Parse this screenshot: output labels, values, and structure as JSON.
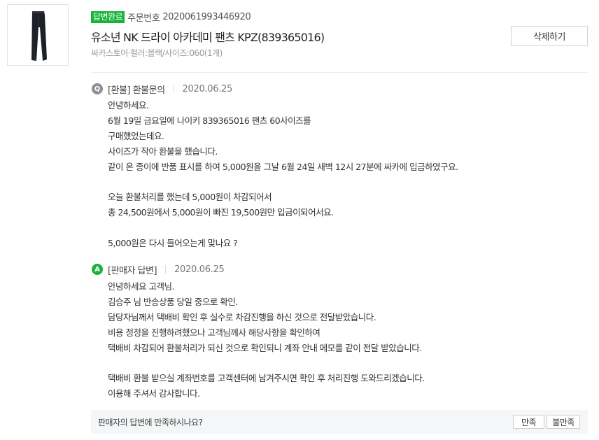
{
  "product": {
    "image_icon": "pants-image",
    "status_badge": "답변완료",
    "order_label": "주문번호",
    "order_number": "2020061993446920",
    "title": "유소년 NK 드라이 아카데미 팬츠 KPZ(839365016)",
    "option": "싸카스토어·컬러:블랙/사이즈:060(1개)",
    "delete_label": "삭제하기"
  },
  "question": {
    "icon_letter": "Q",
    "label": "[환불] 환불문의",
    "date": "2020.06.25",
    "lines": [
      "안녕하세요.",
      "6월 19일 금요일에 나이키 839365016 팬츠 60사이즈를",
      "구매했었는데요.",
      "사이즈가 작아 환불을 했습니다.",
      "같이 온 종이에 반품 표시를 하여 5,000원을 그날 6월 24일 새벽 12시 27분에 싸카에 입금하였구요.",
      "",
      "오늘 환불처리를 했는데 5,000원이 차감되어서",
      "총 24,500원에서 5,000원이 빠진 19,500원만 입금이되어서요.",
      "",
      "5,000원은 다시 들어오는게 맞나요 ?"
    ]
  },
  "answer": {
    "icon_letter": "A",
    "label": "[판매자 답변]",
    "date": "2020.06.25",
    "lines": [
      "안녕하세요 고객님.",
      "김승주 님 반송상품 당일 중으로 확인.",
      "담당자님께서 택배비 확인 후 실수로 차감진행을 하신 것으로 전달받았습니다.",
      "비용 정정을 진행하려했으나 고객님께사 해당사항을 확인하여",
      "택배비 차감되어 환불처리가 되신 것으로 확인되니 계좌 안내 메모를 같이 전달 받았습니다.",
      "",
      "택배비 환불 받으실 계좌번호를 고객센터에 남겨주시면 확인 후 처리진행 도와드리겠습니다.",
      "이용해 주셔서 감사합니다."
    ]
  },
  "survey": {
    "question": "판매자의 답변에 만족하시나요?",
    "satisfied_label": "만족",
    "unsatisfied_label": "불만족"
  },
  "colors": {
    "accent_green": "#19b33a",
    "question_gray": "#8b9096"
  }
}
